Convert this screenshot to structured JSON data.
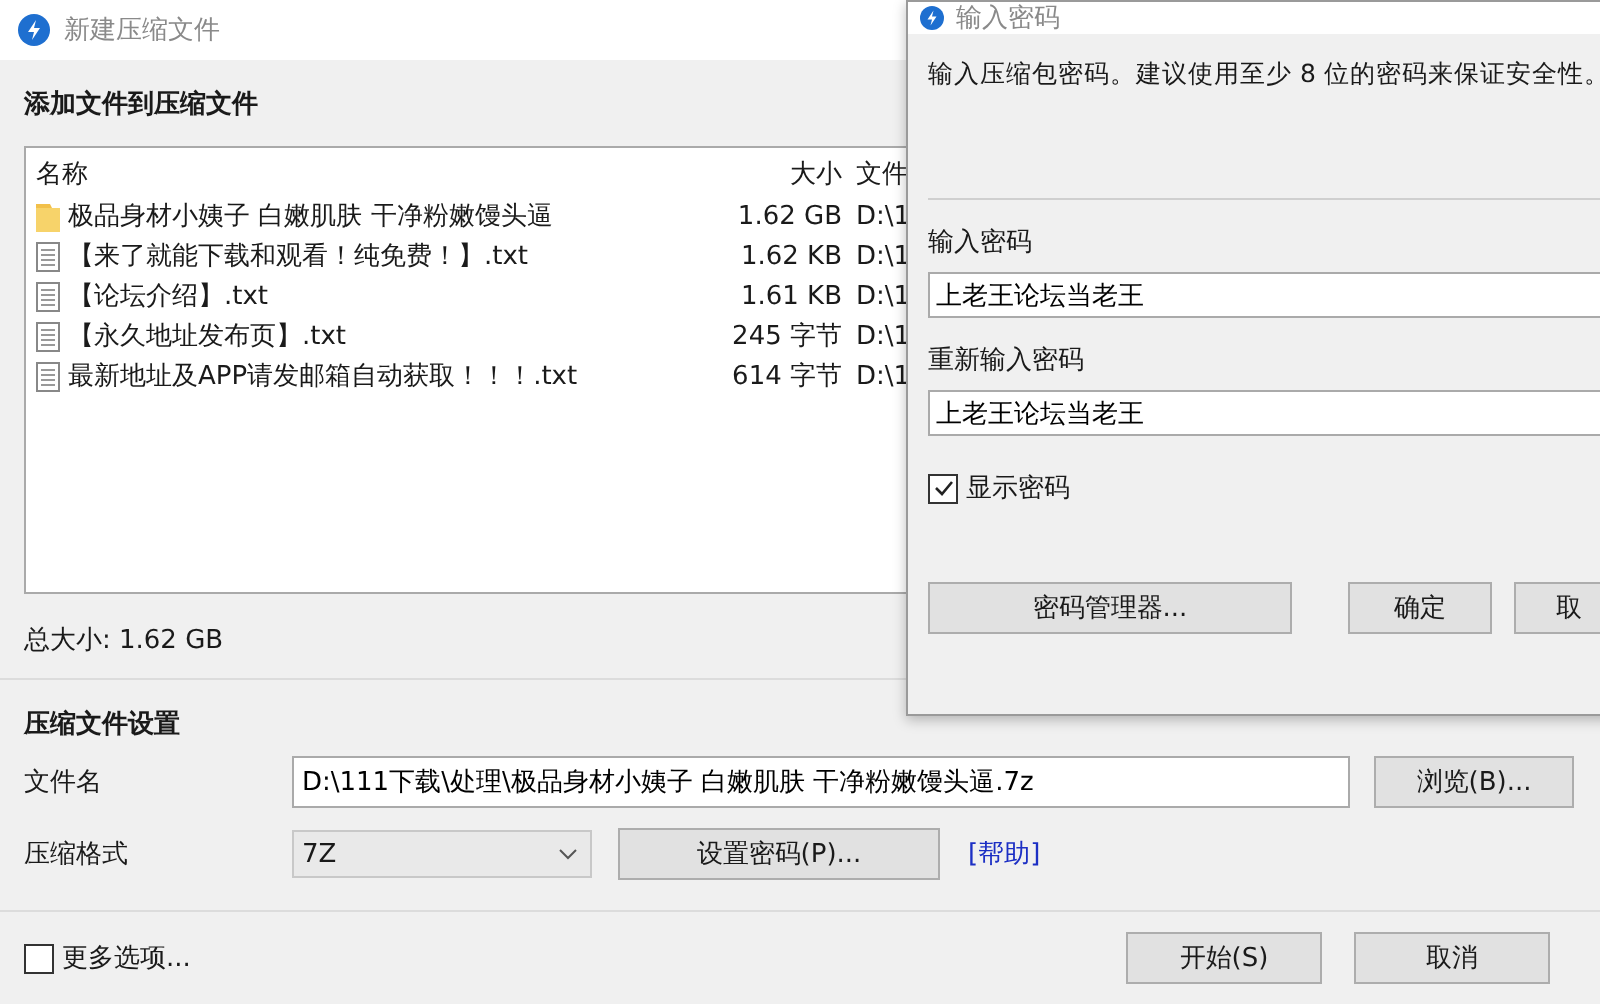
{
  "main_window": {
    "title": "新建压缩文件",
    "section_title": "添加文件到压缩文件",
    "file_list": {
      "columns": [
        "名称",
        "大小",
        "文件"
      ],
      "rows": [
        {
          "kind": "folder",
          "name": "极品身材小姨子 白嫩肌肤 干净粉嫩馒头逼",
          "size": "1.62 GB",
          "path": "D:\\1"
        },
        {
          "kind": "file",
          "name": "【来了就能下载和观看！纯免费！】.txt",
          "size": "1.62 KB",
          "path": "D:\\1"
        },
        {
          "kind": "file",
          "name": "【论坛介绍】.txt",
          "size": "1.61 KB",
          "path": "D:\\1"
        },
        {
          "kind": "file",
          "name": "【永久地址发布页】.txt",
          "size": "245 字节",
          "path": "D:\\1"
        },
        {
          "kind": "file",
          "name": "最新地址及APP请发邮箱自动获取！！！.txt",
          "size": "614 字节",
          "path": "D:\\1"
        }
      ]
    },
    "total_size": "总大小: 1.62 GB",
    "settings": {
      "title": "压缩文件设置",
      "filename_label": "文件名",
      "filename_value": "D:\\111下载\\处理\\极品身材小姨子 白嫩肌肤 干净粉嫩馒头逼.7z",
      "browse_button": "浏览(B)...",
      "format_label": "压缩格式",
      "format_value": "7Z",
      "set_password_button": "设置密码(P)...",
      "help_link": "[帮助]"
    },
    "more_options": {
      "label": "更多选项...",
      "checked": false
    },
    "buttons": [
      "开始(S)",
      "取消"
    ]
  },
  "password_dialog": {
    "title": "输入密码",
    "description": "输入压缩包密码。建议使用至少 8 位的密码来保证安全性。",
    "password_label": "输入密码",
    "password_value": "上老王论坛当老王",
    "repeat_label": "重新输入密码",
    "repeat_value": "上老王论坛当老王",
    "show_password": {
      "label": "显示密码",
      "checked": true
    },
    "buttons": [
      "密码管理器...",
      "确定",
      "取"
    ]
  }
}
